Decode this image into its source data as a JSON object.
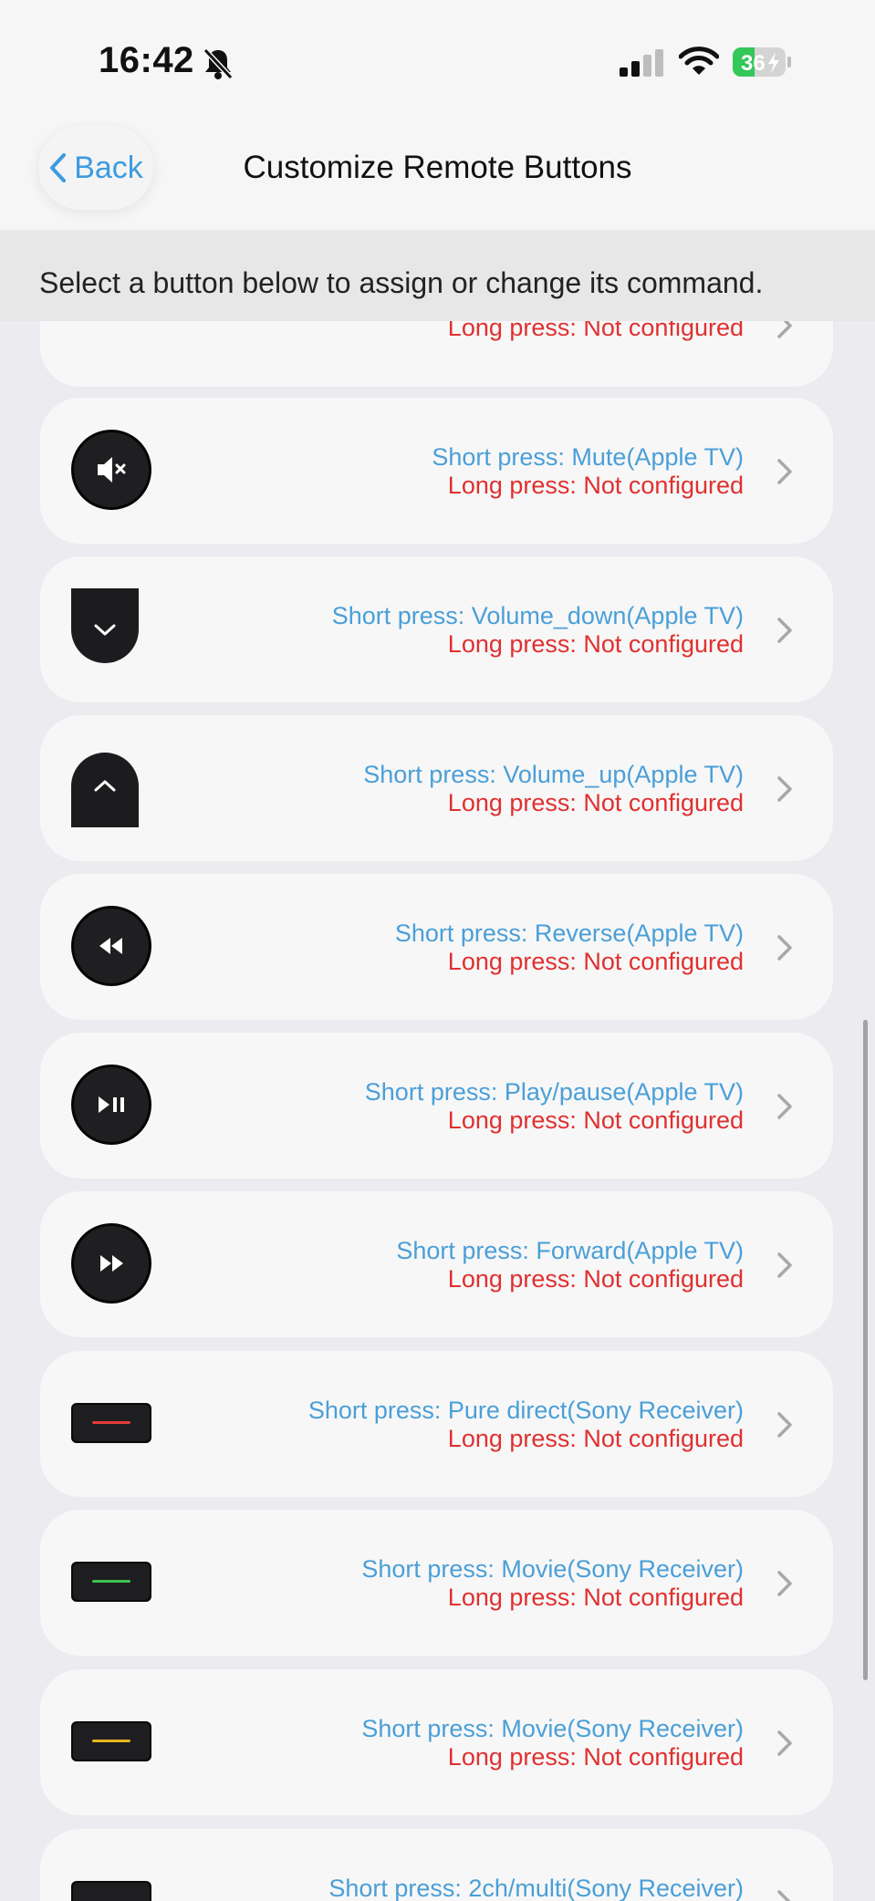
{
  "status_bar": {
    "time": "16:42",
    "battery": "36"
  },
  "nav": {
    "back_label": "Back",
    "title": "Customize Remote Buttons"
  },
  "subtitle": "Select a button below to assign or change its command.",
  "colors": {
    "short_press": "#4a9fd8",
    "long_press": "#e03030",
    "card_bg": "#f7f7f7",
    "accent": "#3d9be0"
  },
  "buttons": [
    {
      "icon": "dark-round-button-icon",
      "short": "",
      "long": "Long press: Not configured"
    },
    {
      "icon": "mute-icon",
      "short": "Short press: Mute(Apple TV)",
      "long": "Long press: Not configured"
    },
    {
      "icon": "volume-down-icon",
      "short": "Short press: Volume_down(Apple TV)",
      "long": "Long press: Not configured"
    },
    {
      "icon": "volume-up-icon",
      "short": "Short press: Volume_up(Apple TV)",
      "long": "Long press: Not configured"
    },
    {
      "icon": "rewind-icon",
      "short": "Short press: Reverse(Apple TV)",
      "long": "Long press: Not configured"
    },
    {
      "icon": "play-pause-icon",
      "short": "Short press: Play/pause(Apple TV)",
      "long": "Long press: Not configured"
    },
    {
      "icon": "fast-forward-icon",
      "short": "Short press: Forward(Apple TV)",
      "long": "Long press: Not configured"
    },
    {
      "icon": "red-color-button-icon",
      "short": "Short press: Pure direct(Sony Receiver)",
      "long": "Long press: Not configured"
    },
    {
      "icon": "green-color-button-icon",
      "short": "Short press: Movie(Sony Receiver)",
      "long": "Long press: Not configured"
    },
    {
      "icon": "yellow-color-button-icon",
      "short": "Short press: Movie(Sony Receiver)",
      "long": "Long press: Not configured"
    },
    {
      "icon": "blue-color-button-icon",
      "short": "Short press: 2ch/multi(Sony Receiver)",
      "long": ""
    }
  ]
}
